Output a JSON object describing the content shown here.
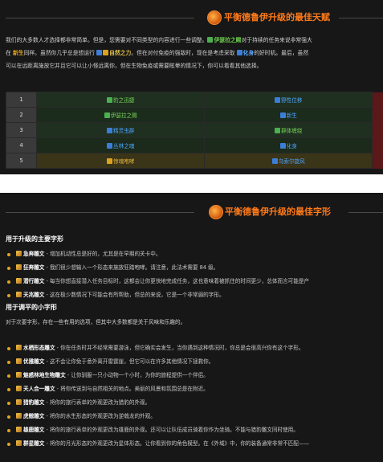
{
  "panel1": {
    "title": "平衡德鲁伊升级的最佳天赋",
    "intro_lines": [
      {
        "parts": [
          {
            "t": "我们的大多数人才选择都非常简单。但是，您需要对不同类型的内容进行一些调整。",
            "c": ""
          },
          {
            "t": "伊瑟拉之赐",
            "c": "sp",
            "icon": "green"
          },
          {
            "t": "对于持续的任务来说非常强大",
            "c": ""
          }
        ]
      },
      {
        "parts": [
          {
            "t": "在 ",
            "c": ""
          },
          {
            "t": "新生",
            "c": "n"
          },
          {
            "t": "同样。虽然你几乎总是想运行 ",
            "c": "",
            "icon": "blue"
          },
          {
            "t": "自然之力",
            "c": "sp3",
            "icon": "yellow"
          },
          {
            "t": "。但在对付免疫的强敌时，现在是考虑采取 ",
            "c": ""
          },
          {
            "t": "化身",
            "c": "sp2",
            "icon": "blue"
          },
          {
            "t": "的好时机。最后，虽然",
            "c": ""
          }
        ]
      },
      {
        "parts": [
          {
            "t": "可以在远距离施放它并且它可以让小怪远离你，但在生物免疫或需要眩晕的情况下，你可以看看其他选择。",
            "c": ""
          }
        ]
      }
    ],
    "talents": [
      {
        "level": "1",
        "left": "豹之迅捷",
        "left_color": "t-g",
        "right": "野性位移",
        "right_color": "t-b",
        "row": "row-a"
      },
      {
        "level": "2",
        "left": "伊瑟拉之赐",
        "left_color": "t-g",
        "right": "新生",
        "right_color": "t-b",
        "row": "row-b"
      },
      {
        "level": "3",
        "left": "精灵虫群",
        "left_color": "t-b",
        "right": "群体缠绕",
        "right_color": "t-g",
        "row": "row-c"
      },
      {
        "level": "4",
        "left": "丛林之魂",
        "left_color": "t-b",
        "right": "化身",
        "right_color": "t-b",
        "row": "row-d"
      },
      {
        "level": "5",
        "left": "惊魂咆哮",
        "left_color": "t-y",
        "right": "乌索尔旋风",
        "right_color": "t-b",
        "row": "row-e"
      }
    ]
  },
  "panel2": {
    "title": "平衡德鲁伊升级的最佳字形",
    "major_heading": "用于升级的主要字形",
    "major": [
      {
        "name": "急奔雕文",
        "text": " - 增加机动性总是好的，尤其是在早期的关卡中。"
      },
      {
        "name": "狂奔雕文",
        "text": " - 我们很少想输入一个形态来施放狂踏咆哮。请注意，此法术需要 84 级。"
      },
      {
        "name": "潜行雕文",
        "text": " - 每当你想直接潜入任务目标时，这都会让你更快地完成任务，这也意味着被抓住的时间更少，总体而言可能是产"
      },
      {
        "name": "天兆雕文",
        "text": " - 这在极少数情况下可能会有所帮助，但总的来说，它是一个非常弱的字形。"
      }
    ],
    "minor_heading": "用于调平的小字形",
    "minor_desc": "对于次要字形，存在一些有用的选项，但其中大多数都是关于风味和乐趣的。",
    "minor": [
      {
        "name": "水栖形态雕文",
        "text": " - 你在任务时并不经常需要游泳，但它确实会发生，当你遇到这种情况时，你总是会很高兴你有这个字形。"
      },
      {
        "name": "优雅雕文",
        "text": " - 这不会让你免于意外离开雷霆崖，但它可以在许多其他情况下拯救你。"
      },
      {
        "name": "魅惑林地生物雕文",
        "text": " - 让你驯服一只小动物一个小时，为你的旅程提供一个伴侣。"
      },
      {
        "name": "天人合一雕文",
        "text": " - 将你传送到与自然相关的地点。美丽的风景和氛围总是在附近。"
      },
      {
        "name": "猎豹雕文",
        "text": " - 将你的旅行表单的外观更改为猎豹的外观。"
      },
      {
        "name": "虎鲸雕文",
        "text": " - 将你的水生形态的外观更改为逆戟龙的外观。"
      },
      {
        "name": "雄鹿雕文",
        "text": " - 将你的旅行表单的外观更改为雄鹿的外观。还可以让队伍成员骑着你作为坐骑。不能与猎豹雕文同时使用。"
      },
      {
        "name": "群星雕文",
        "text": " - 将你的月光形态的外观更改为星体形态。让你看到你的角色模型。在《外域》中，你的装备通常非常不匹配——"
      }
    ]
  },
  "colors": {
    "accent": "#ff7a1a",
    "background": "#171717"
  }
}
